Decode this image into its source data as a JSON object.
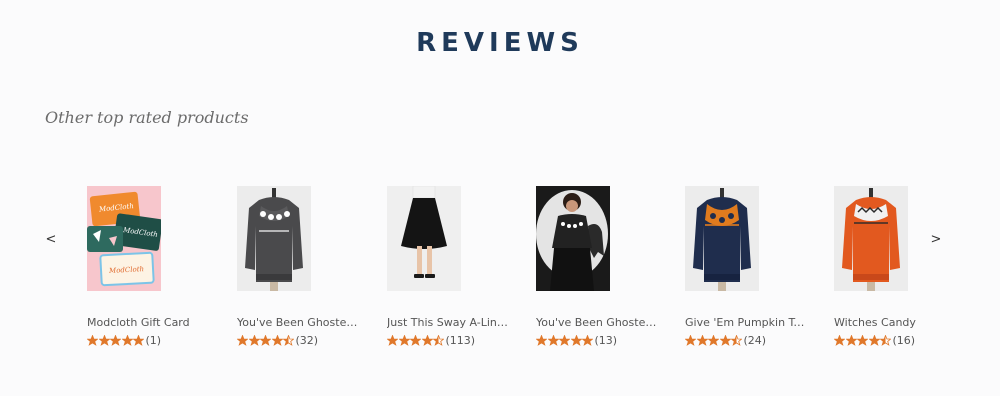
{
  "section": {
    "title": "REVIEWS",
    "subtitle": "Other top rated products"
  },
  "carousel": {
    "prev_icon": "chevron-left-icon",
    "next_icon": "chevron-right-icon",
    "prev_glyph": "<",
    "next_glyph": ">"
  },
  "colors": {
    "title": "#1f3a5a",
    "star": "#e0782b",
    "star_empty": "#d8d8d8"
  },
  "products": [
    {
      "name": "Modcloth Gift Card",
      "rating": 5,
      "review_count": "(1)",
      "image": "gift-card-image"
    },
    {
      "name": "You've Been Ghosted F...",
      "rating": 4.5,
      "review_count": "(32)",
      "image": "gray-ghost-sweater-image"
    },
    {
      "name": "Just This Sway A-Line Skirt",
      "rating": 4.5,
      "review_count": "(113)",
      "image": "black-skirt-image"
    },
    {
      "name": "You've Been Ghosted F...",
      "rating": 5,
      "review_count": "(13)",
      "image": "model-ghost-sweater-image"
    },
    {
      "name": "Give 'Em Pumpkin To Ta...",
      "rating": 4.5,
      "review_count": "(24)",
      "image": "navy-pumpkin-sweater-image"
    },
    {
      "name": "Witches Candy",
      "rating": 4.5,
      "review_count": "(16)",
      "image": "orange-sweater-image"
    }
  ]
}
